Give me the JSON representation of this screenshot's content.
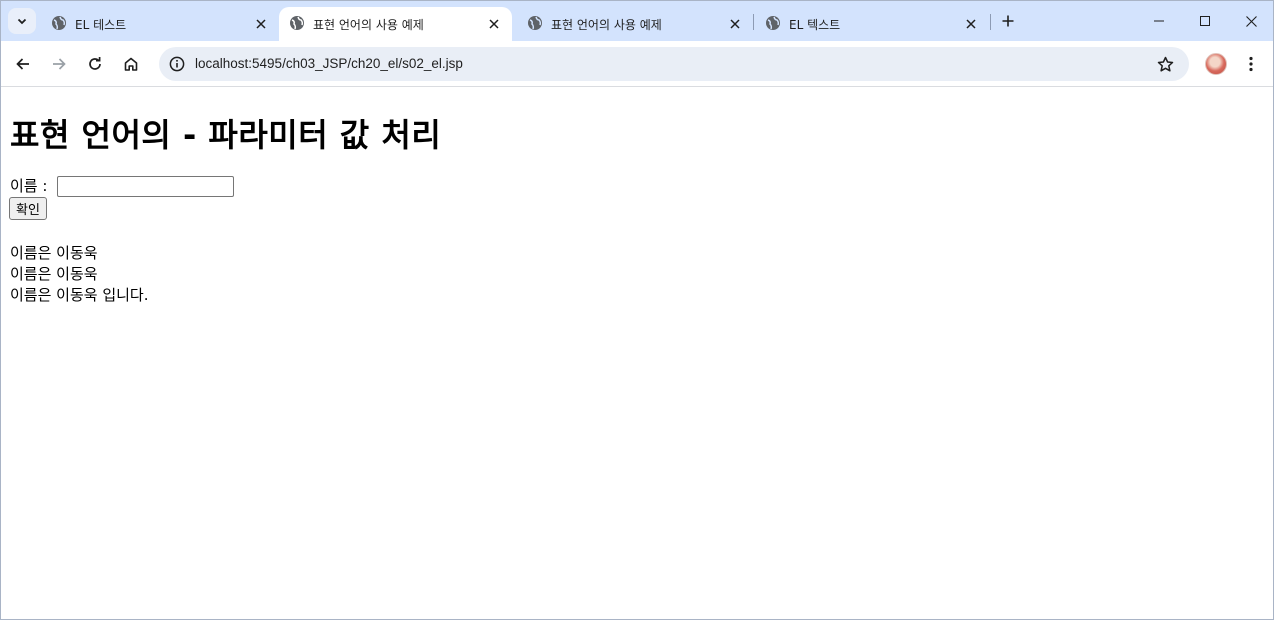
{
  "browser": {
    "tabs": [
      {
        "title": "EL 테스트",
        "active": false
      },
      {
        "title": "표현 언어의 사용 예제",
        "active": true
      },
      {
        "title": "표현 언어의 사용 예제",
        "active": false
      },
      {
        "title": "EL 텍스트",
        "active": false
      }
    ],
    "new_tab_icon": "plus-icon",
    "address": "localhost:5495/ch03_JSP/ch20_el/s02_el.jsp",
    "colors": {
      "tabstrip": "#d3e3fd",
      "omnibox": "#e9eef6"
    }
  },
  "page": {
    "heading": "표현 언어의 - 파라미터 값 처리",
    "form": {
      "name_label": "이름 :",
      "name_value": "",
      "submit_label": "확인"
    },
    "results": [
      "이름은 이동욱",
      "이름은 이동욱",
      "이름은 이동욱 입니다."
    ]
  }
}
